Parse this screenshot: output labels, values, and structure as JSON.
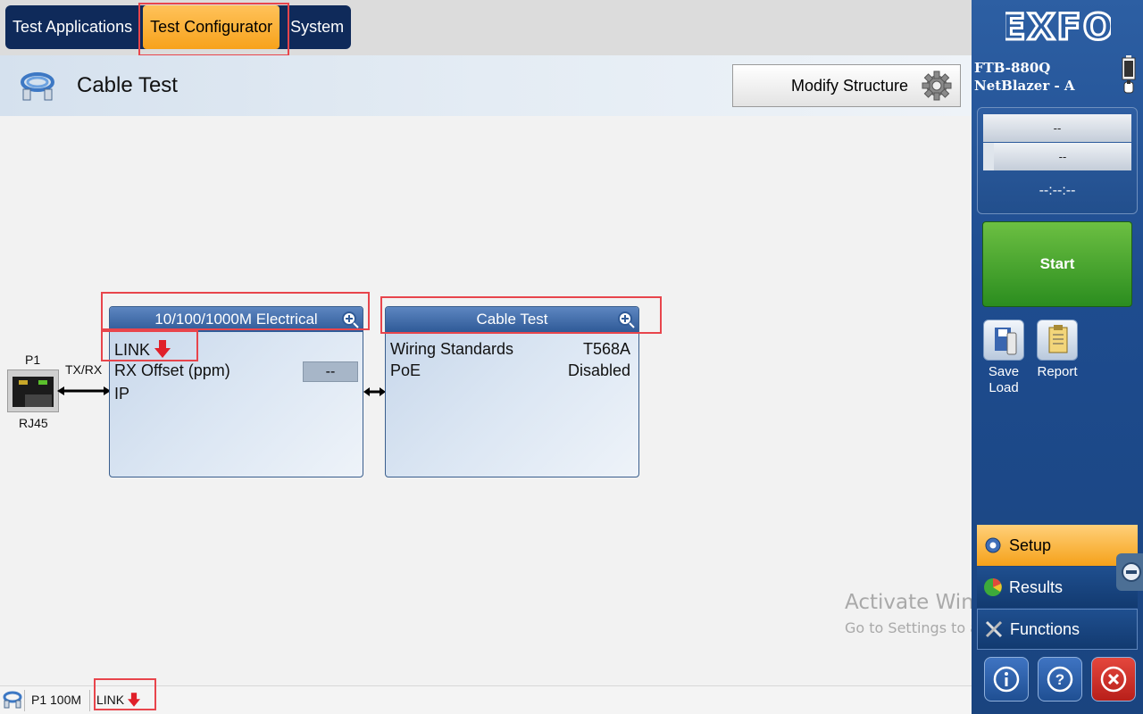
{
  "tabs": [
    {
      "label": "Test Applications"
    },
    {
      "label": "Test Configurator",
      "active": true
    },
    {
      "label": "System"
    }
  ],
  "header": {
    "title": "Cable Test",
    "modify_button": "Modify Structure"
  },
  "diagram": {
    "port_name": "P1",
    "port_type": "RJ45",
    "link_label": "TX/RX",
    "electrical_block": {
      "title": "10/100/1000M Electrical",
      "rows": [
        {
          "label": "LINK",
          "indicator": "down-arrow-red"
        },
        {
          "label": "RX Offset (ppm)",
          "value": "--"
        },
        {
          "label": "IP"
        }
      ]
    },
    "cable_block": {
      "title": "Cable Test",
      "rows": [
        {
          "label": "Wiring Standards",
          "value": "T568A"
        },
        {
          "label": "PoE",
          "value": "Disabled"
        }
      ]
    }
  },
  "right_panel": {
    "brand": "EXFO",
    "model_line1": "FTB-880Q",
    "model_line2": "NetBlazer  - A",
    "status_top": "--",
    "status_bottom": "--",
    "timer": "--:--:--",
    "start_label": "Start",
    "save_load_line1": "Save",
    "save_load_line2": "Load",
    "report_label": "Report",
    "nav": [
      {
        "label": "Setup",
        "active": true
      },
      {
        "label": "Results"
      },
      {
        "label": "Functions"
      }
    ]
  },
  "watermark": {
    "line1": "Activate Windows",
    "line2": "Go to Settings to activate Windows."
  },
  "statusbar": {
    "port_speed": "P1 100M",
    "link": "LINK"
  },
  "colors": {
    "accent_orange": "#f7a21b",
    "panel_blue": "#1e4c8f",
    "start_green": "#2b8d1f",
    "highlight_red": "#e8454c",
    "link_down_red": "#e0202a"
  }
}
